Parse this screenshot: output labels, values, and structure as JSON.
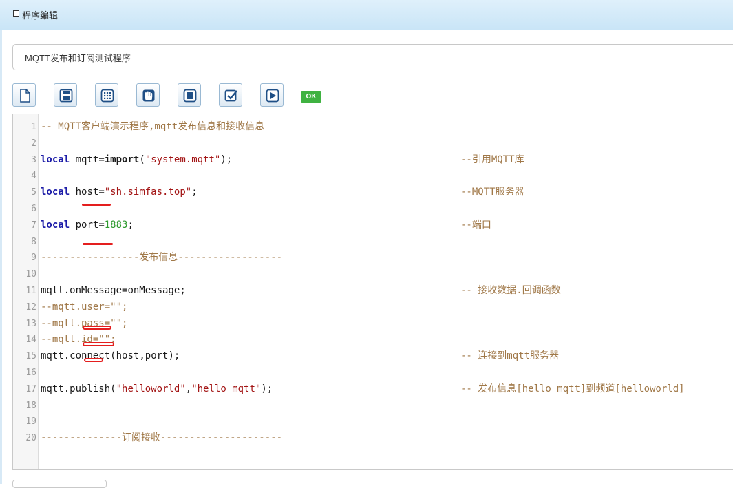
{
  "panel": {
    "title": "程序编辑"
  },
  "program_title": {
    "value": "MQTT发布和订阅测试程序"
  },
  "toolbar": {
    "buttons": [
      {
        "name": "new-file",
        "icon": "new-file-icon"
      },
      {
        "name": "save",
        "icon": "save-icon"
      },
      {
        "name": "keypad",
        "icon": "keypad-icon"
      },
      {
        "name": "hand",
        "icon": "hand-icon"
      },
      {
        "name": "stop",
        "icon": "stop-icon"
      },
      {
        "name": "check",
        "icon": "check-icon"
      },
      {
        "name": "run",
        "icon": "play-icon"
      }
    ],
    "status": "OK"
  },
  "editor": {
    "lines": [
      {
        "n": "1",
        "code": "-- MQTT客户端演示程序,mqtt发布信息和接收信息",
        "comment": ""
      },
      {
        "n": "2",
        "code": "",
        "comment": ""
      },
      {
        "n": "3",
        "code": "local mqtt=import(\"system.mqtt\");",
        "comment": "--引用MQTT库"
      },
      {
        "n": "4",
        "code": "",
        "comment": ""
      },
      {
        "n": "5",
        "code": "local host=\"sh.simfas.top\";",
        "comment": "--MQTT服务器"
      },
      {
        "n": "6",
        "code": "",
        "comment": ""
      },
      {
        "n": "7",
        "code": "local port=1883;",
        "comment": "--端口"
      },
      {
        "n": "8",
        "code": "",
        "comment": ""
      },
      {
        "n": "9",
        "code": "-----------------发布信息------------------",
        "comment": ""
      },
      {
        "n": "10",
        "code": "",
        "comment": ""
      },
      {
        "n": "11",
        "code": "mqtt.onMessage=onMessage;",
        "comment": "-- 接收数据.回调函数"
      },
      {
        "n": "12",
        "code": "--mqtt.user=\"\";",
        "comment": ""
      },
      {
        "n": "13",
        "code": "--mqtt.pass=\"\";",
        "comment": ""
      },
      {
        "n": "14",
        "code": "--mqtt.id=\"\";",
        "comment": ""
      },
      {
        "n": "15",
        "code": "mqtt.connect(host,port);",
        "comment": "-- 连接到mqtt服务器"
      },
      {
        "n": "16",
        "code": "",
        "comment": ""
      },
      {
        "n": "17",
        "code": "mqtt.publish(\"helloworld\",\"hello mqtt\");",
        "comment": "-- 发布信息[hello mqtt]到频道[helloworld]"
      },
      {
        "n": "18",
        "code": "",
        "comment": ""
      },
      {
        "n": "19",
        "code": "",
        "comment": ""
      },
      {
        "n": "20",
        "code": "--------------订阅接收---------------------",
        "comment": ""
      }
    ]
  },
  "colors": {
    "keyword": "#1c1ca8",
    "string": "#a31515",
    "number": "#2e9a2e",
    "comment": "#a07848",
    "annotation": "#e41e1e",
    "ok_badge": "#3fb241"
  }
}
